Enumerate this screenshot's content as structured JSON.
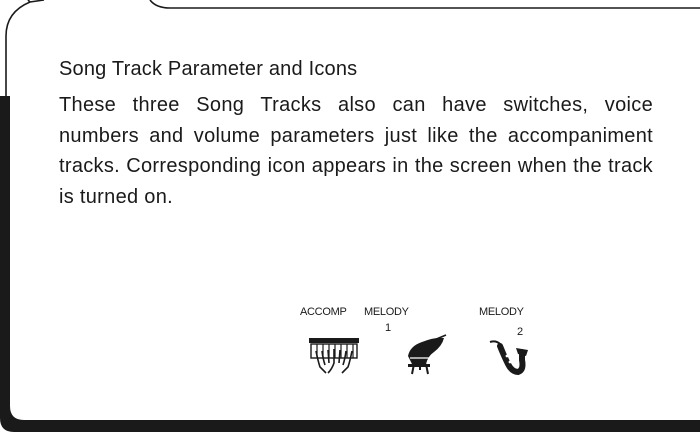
{
  "section": {
    "heading": "Song Track Parameter and Icons",
    "body": "These three Song Tracks also can have switches, voice numbers and volume parameters just like the accompaniment tracks. Corresponding icon appears in the screen when the track is turned on."
  },
  "icons": [
    {
      "label": "ACCOMP",
      "number": "",
      "icon": "hands-on-keyboard-icon"
    },
    {
      "label": "MELODY",
      "number": "1",
      "icon": "piano-icon"
    },
    {
      "label": "MELODY",
      "number": "2",
      "icon": "saxophone-icon"
    }
  ]
}
